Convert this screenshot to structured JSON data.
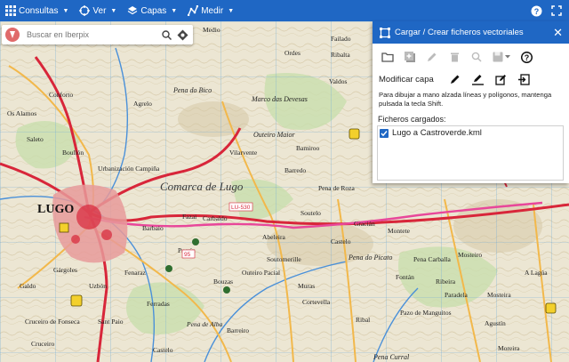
{
  "topbar": {
    "items": [
      {
        "label": "Consultas",
        "icon": "grid-icon"
      },
      {
        "label": "Ver",
        "icon": "globe-icon"
      },
      {
        "label": "Capas",
        "icon": "layers-icon"
      },
      {
        "label": "Medir",
        "icon": "measure-icon"
      }
    ],
    "right_icons": [
      "help-icon",
      "fullscreen-icon"
    ]
  },
  "search": {
    "placeholder": "Buscar en Iberpix"
  },
  "panel": {
    "title": "Cargar / Crear ficheros vectoriales",
    "modify_label": "Modificar capa",
    "hint": "Para dibujar a mano alzada líneas y polígonos, mantenga pulsada la tecla Shift.",
    "files_label": "Ficheros cargados:",
    "files": [
      {
        "name": "Lugo a Castroverde.kml",
        "checked": true
      }
    ]
  },
  "map": {
    "labels": [
      "Medio",
      "Failado",
      "Ordes",
      "Ribalta",
      "Pena do Bico",
      "Agrelo",
      "Marco das Devesas",
      "Valdos",
      "Conforto",
      "Os Alamos",
      "Saleto",
      "Outeiro Maior",
      "Barredo",
      "Bamiroo",
      "Pena de Roza",
      "Comarca de Lugo",
      "LUGO",
      "Urbanización Campiña",
      "Barbaio",
      "Fazai",
      "Carbaldo",
      "Soutelo",
      "Pena do Picato",
      "Castelo",
      "Montete",
      "Mosteiro",
      "Ribal",
      "Pazo de Manguitos",
      "Agustín",
      "Pena Curral",
      "Cortevella",
      "Barreiro",
      "Ribeira",
      "Mosteira",
      "A Lagúa",
      "Vilarvente",
      "Bouzas",
      "Soutomerille",
      "Outeiro Pacial",
      "Paradela",
      "Uzbón",
      "Ferradas",
      "Cruceiro de Fonseca",
      "Pucrín",
      "Gárgoles",
      "Sant Paio",
      "Castelo",
      "Pena de Alba",
      "Galdo",
      "Moreira",
      "Pena Carballa",
      "Fontán",
      "Cruceiro",
      "Gracián",
      "Abeleira",
      "Muras",
      "Fenaraz",
      "Boullón"
    ],
    "road_label": "LU-530",
    "road_number": "95"
  }
}
